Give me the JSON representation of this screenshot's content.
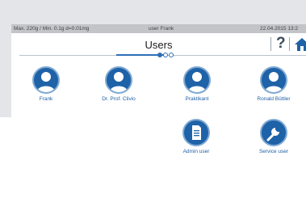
{
  "status": {
    "capacity": "Max. 220g / Min. 0.1g  d=0.01mg",
    "user": "user Frank",
    "datetime": "22.04.2015  13:2"
  },
  "header": {
    "title": "Users",
    "help_label": "?",
    "page_count": 3,
    "current_page": 1
  },
  "users": [
    {
      "label": "Frank",
      "icon": "user-icon"
    },
    {
      "label": "Dr. Prof. Clivio",
      "icon": "user-icon"
    },
    {
      "label": "Praktikant",
      "icon": "user-icon"
    },
    {
      "label": "Ronald Büttler",
      "icon": "user-icon"
    }
  ],
  "actions": [
    {
      "label": "Admin user",
      "icon": "document-icon"
    },
    {
      "label": "Service user",
      "icon": "wrench-icon"
    }
  ],
  "colors": {
    "accent": "#1e62a8",
    "label": "#1f5fa6",
    "statusbar": "#c2c4c8"
  }
}
